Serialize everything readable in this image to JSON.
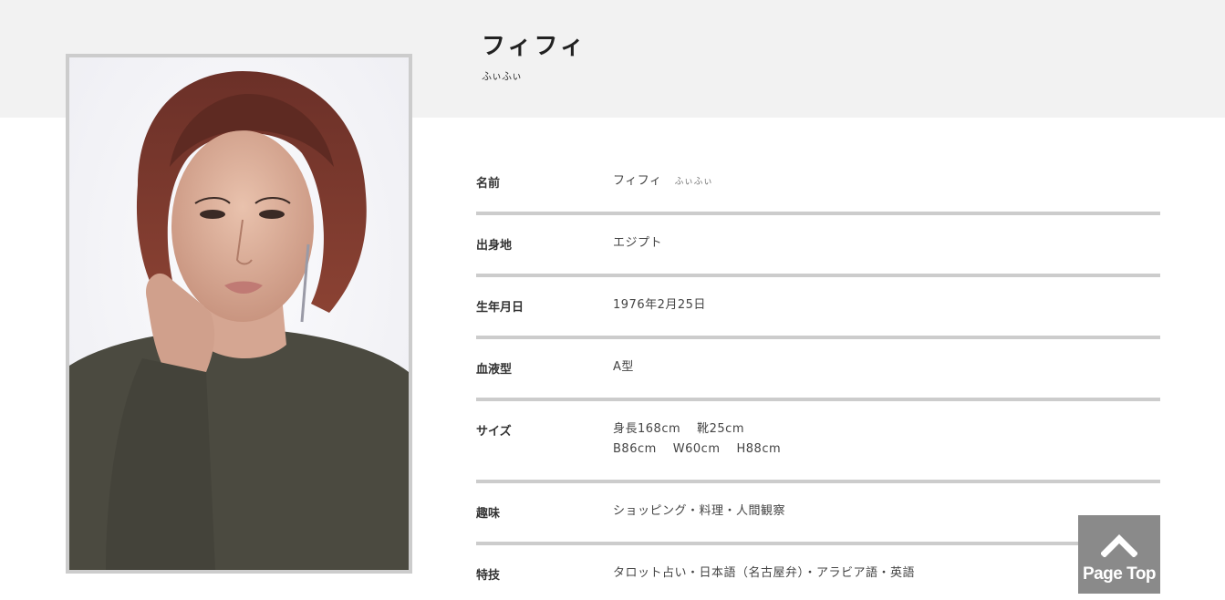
{
  "profile": {
    "name": "フィフィ",
    "kana": "ふぃふぃ"
  },
  "table": {
    "rows": [
      {
        "label": "名前",
        "value": "フィフィ",
        "extra": "ふぃふぃ"
      },
      {
        "label": "出身地",
        "value": "エジプト"
      },
      {
        "label": "生年月日",
        "value": "1976年2月25日"
      },
      {
        "label": "血液型",
        "value": "A型"
      },
      {
        "label": "サイズ",
        "line1a": "身長168cm",
        "line1b": "靴25cm",
        "line2a": "B86cm",
        "line2b": "W60cm",
        "line2c": "H88cm"
      },
      {
        "label": "趣味",
        "value": "ショッピング・料理・人間観察"
      },
      {
        "label": "特技",
        "value": "タロット占い・日本語（名古屋弁）・アラビア語・英語"
      }
    ]
  },
  "page_top": {
    "label": "Page Top",
    "icon": "chevron-up-icon"
  },
  "colors": {
    "band": "#f2f2f2",
    "divider": "#cccccc",
    "page_top_bg": "#8a8a8a"
  }
}
